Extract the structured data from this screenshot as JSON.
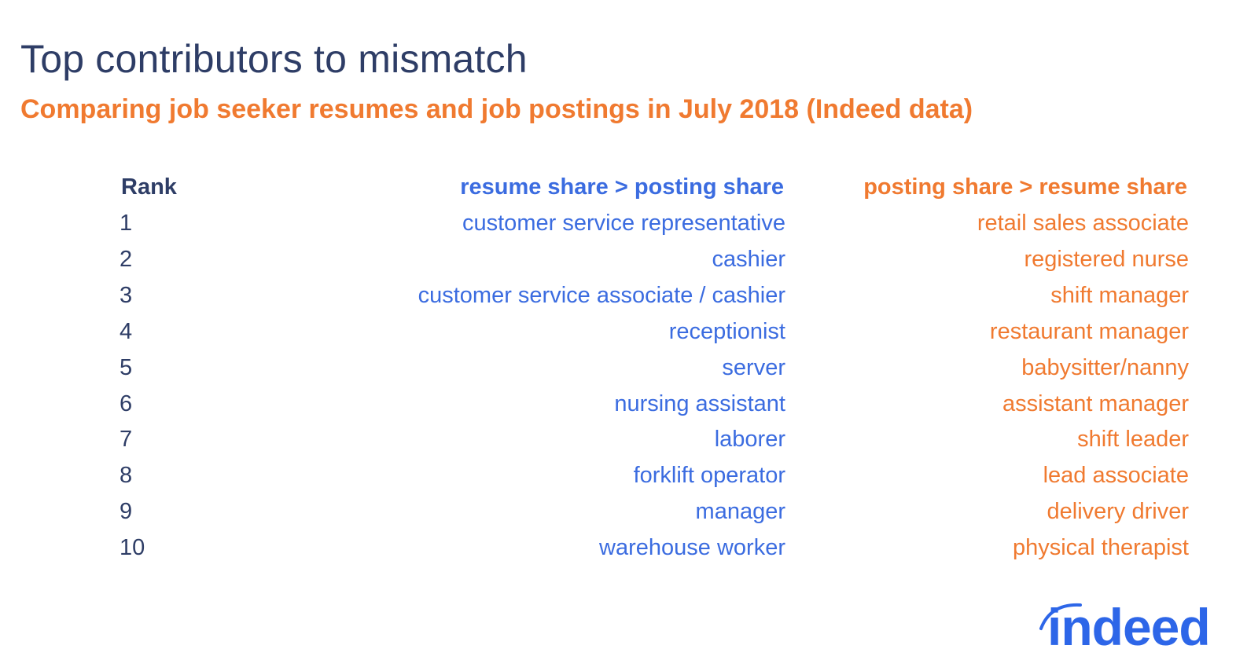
{
  "title": "Top contributors to mismatch",
  "subtitle": "Comparing job seeker resumes and job postings in July 2018 (Indeed data)",
  "table": {
    "headers": {
      "rank": "Rank",
      "resume": "resume share > posting share",
      "posting": "posting share > resume share"
    },
    "rows": [
      {
        "rank": "1",
        "resume": "customer service representative",
        "posting": "retail sales associate"
      },
      {
        "rank": "2",
        "resume": "cashier",
        "posting": "registered nurse"
      },
      {
        "rank": "3",
        "resume": "customer service associate / cashier",
        "posting": "shift manager"
      },
      {
        "rank": "4",
        "resume": "receptionist",
        "posting": "restaurant manager"
      },
      {
        "rank": "5",
        "resume": "server",
        "posting": "babysitter/nanny"
      },
      {
        "rank": "6",
        "resume": "nursing assistant",
        "posting": "assistant manager"
      },
      {
        "rank": "7",
        "resume": "laborer",
        "posting": "shift leader"
      },
      {
        "rank": "8",
        "resume": "forklift operator",
        "posting": "lead associate"
      },
      {
        "rank": "9",
        "resume": "manager",
        "posting": "delivery driver"
      },
      {
        "rank": "10",
        "resume": "warehouse worker",
        "posting": "physical therapist"
      }
    ]
  },
  "logo": {
    "text": "indeed",
    "icon": "indeed-arc-icon"
  },
  "colors": {
    "title": "#2e3d66",
    "accent_orange": "#f07a30",
    "accent_blue": "#3b6ce0",
    "logo_blue": "#2d66e8"
  }
}
